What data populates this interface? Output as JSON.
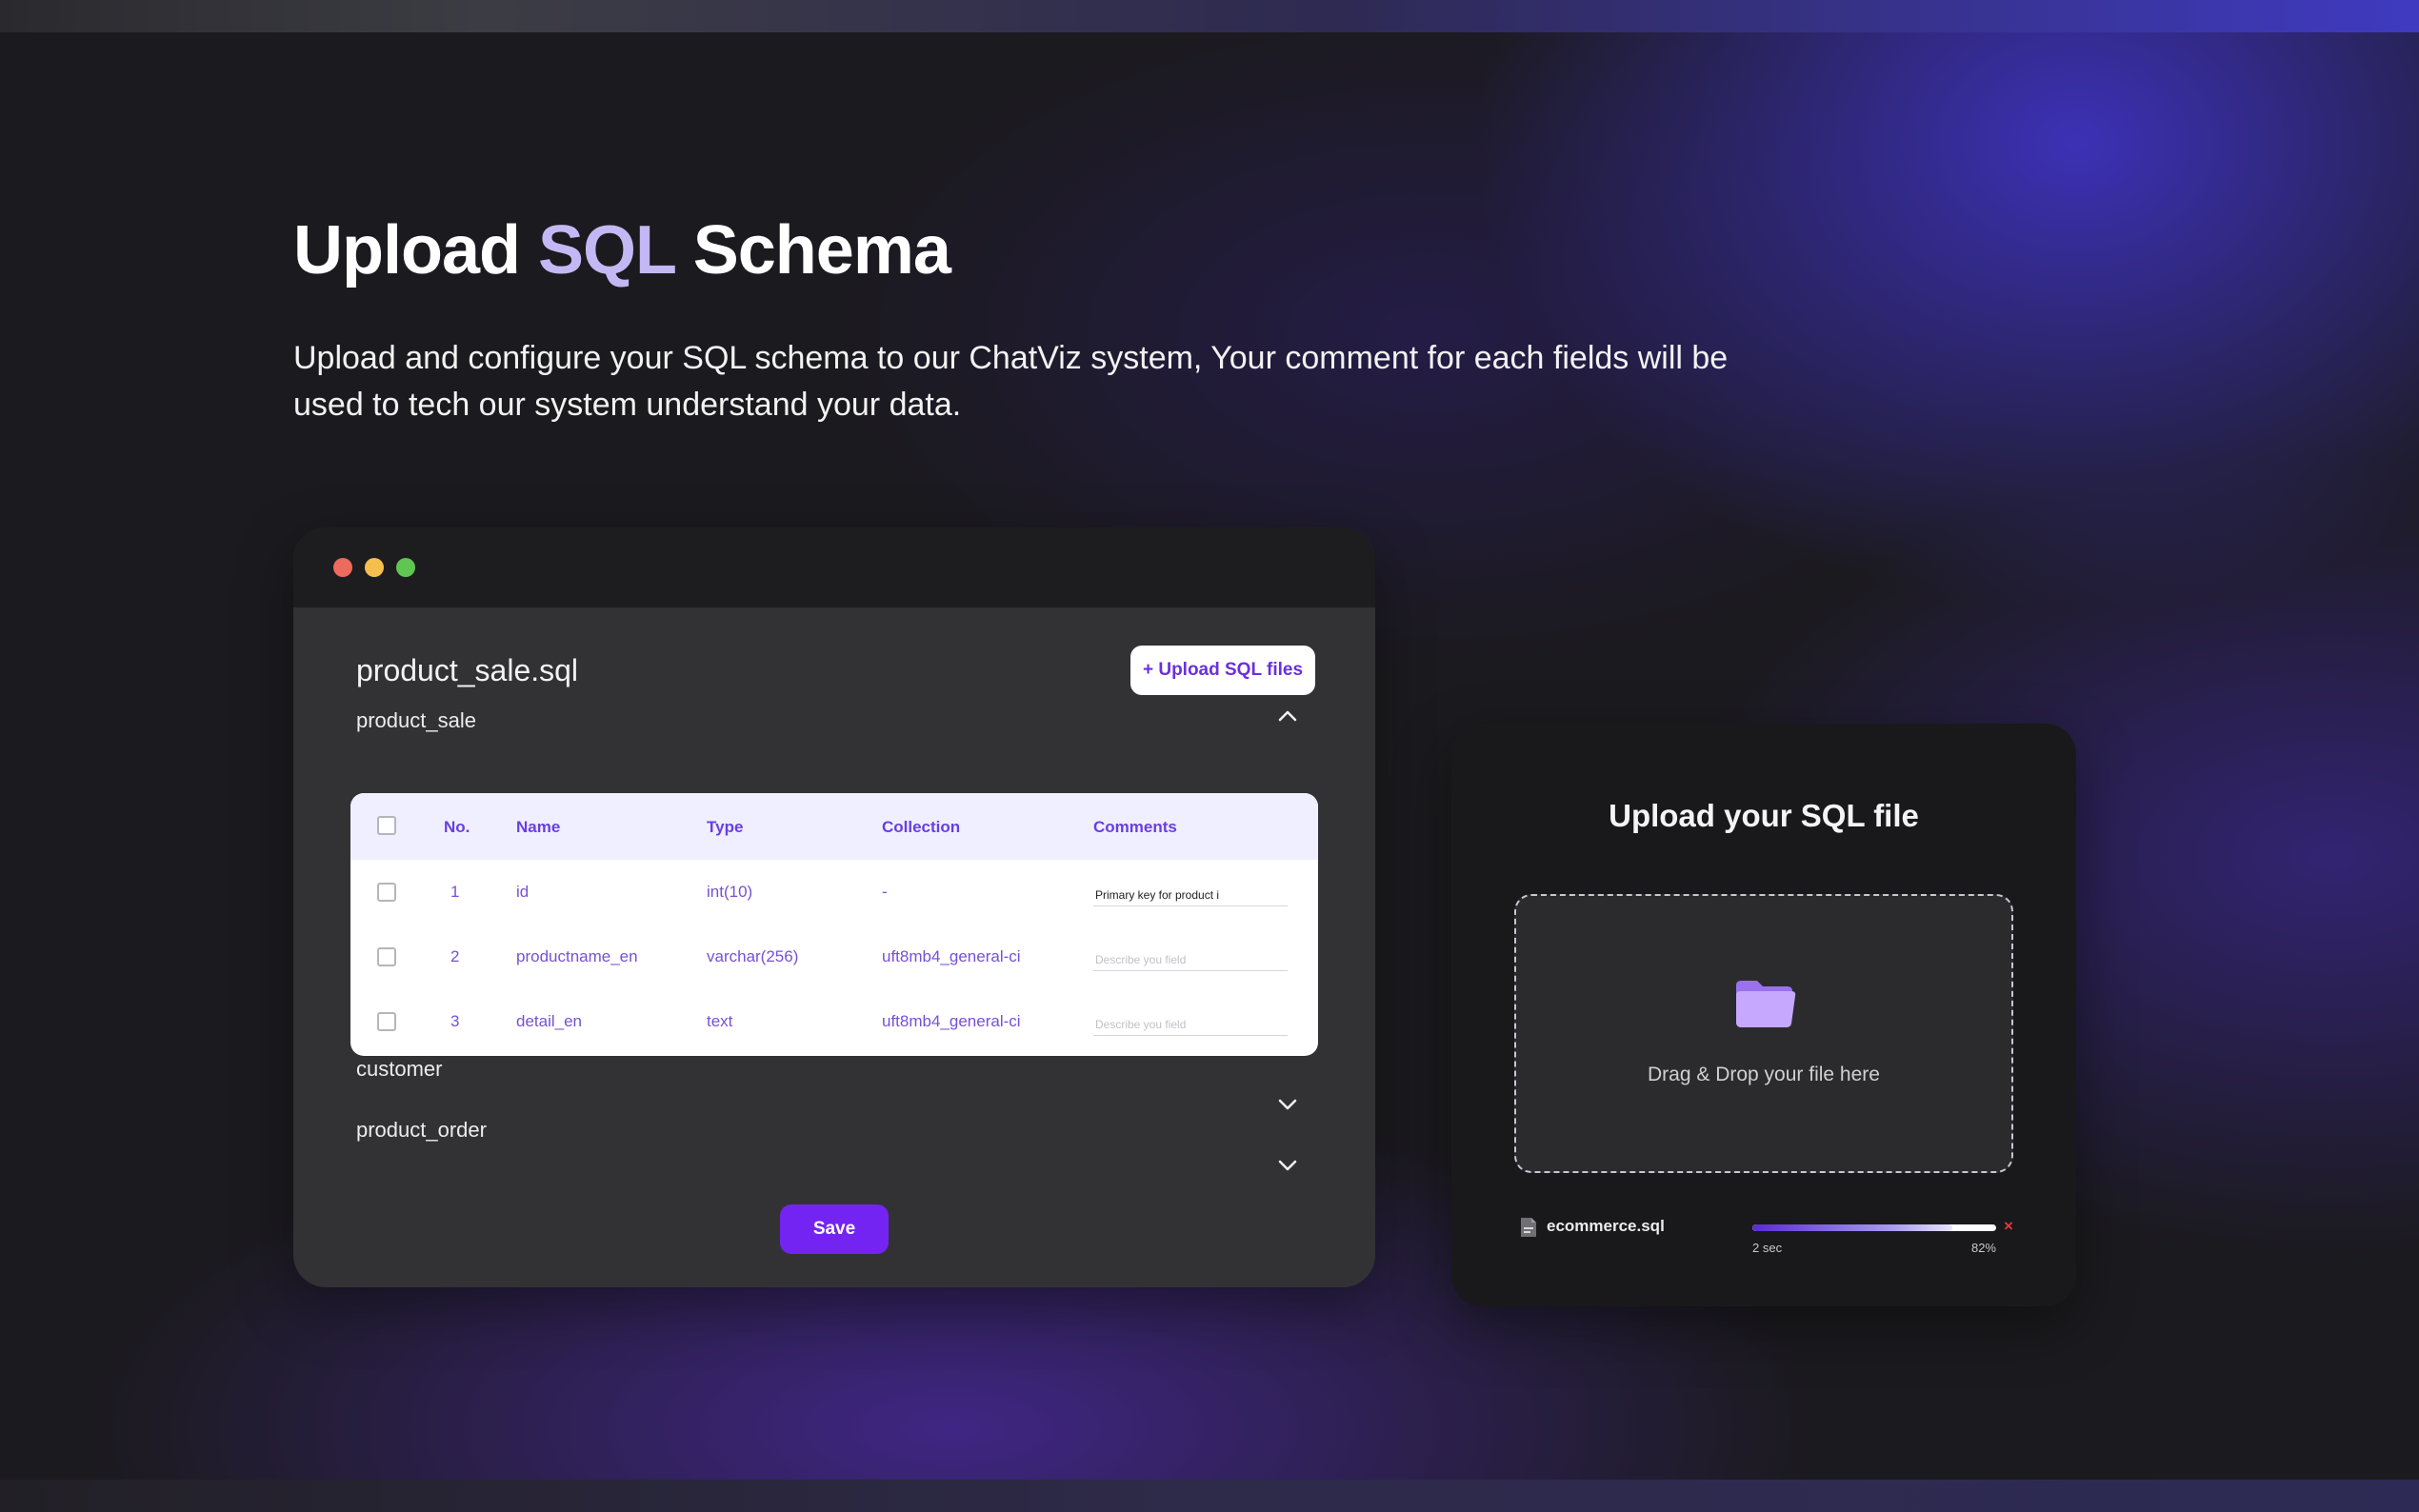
{
  "hero": {
    "title_prefix": "Upload",
    "title_accent": "SQL",
    "title_suffix": "Schema",
    "description": "Upload and configure your SQL schema to our ChatViz system, Your comment for each fields will be used to tech our system understand your data."
  },
  "schema_window": {
    "file_name": "product_sale.sql",
    "upload_button_label": "+ Upload SQL files",
    "tables": [
      {
        "name": "product_sale",
        "expanded": true,
        "columns": [
          "No.",
          "Name",
          "Type",
          "Collection",
          "Comments"
        ],
        "rows": [
          {
            "no": "1",
            "name": "id",
            "type": "int(10)",
            "collection": "-",
            "comment": "Primary key for product i",
            "placeholder": "Describe you field"
          },
          {
            "no": "2",
            "name": "productname_en",
            "type": "varchar(256)",
            "collection": "uft8mb4_general-ci",
            "comment": "",
            "placeholder": "Describe you field"
          },
          {
            "no": "3",
            "name": "detail_en",
            "type": "text",
            "collection": "uft8mb4_general-ci",
            "comment": "",
            "placeholder": "Describe you field"
          }
        ]
      },
      {
        "name": "customer",
        "expanded": false
      },
      {
        "name": "product_order",
        "expanded": false
      }
    ],
    "save_label": "Save"
  },
  "upload_card": {
    "title": "Upload your  SQL file",
    "drop_text": "Drag & Drop your file here",
    "file": {
      "name": "ecommerce.sql",
      "progress_percent": 82,
      "progress_label": "82%",
      "time_label": "2 sec",
      "cancel_icon": "×"
    }
  },
  "colors": {
    "accent": "#7424f2",
    "accent_text": "#c3b8f4",
    "window_dot_red": "#ec6a5e",
    "window_dot_yellow": "#f4bf4f",
    "window_dot_green": "#61c554",
    "cancel": "#e0373d"
  },
  "icons": {
    "collapse": "chevron-up-icon",
    "expand": "chevron-down-icon",
    "folder": "folder-icon",
    "file": "file-icon",
    "cancel": "close-icon"
  }
}
